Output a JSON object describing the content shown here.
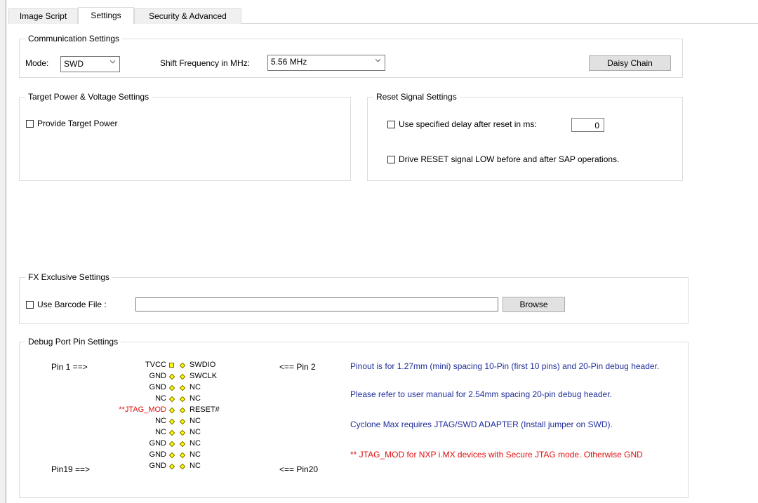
{
  "tabs": [
    {
      "label": "Image Script",
      "active": false
    },
    {
      "label": "Settings",
      "active": true
    },
    {
      "label": "Security & Advanced",
      "active": false
    }
  ],
  "communication": {
    "title": "Communication Settings",
    "mode_label": "Mode:",
    "mode_value": "SWD",
    "freq_label": "Shift Frequency in MHz:",
    "freq_value": "5.56 MHz",
    "daisy_chain_button": "Daisy Chain"
  },
  "target_power": {
    "title": "Target Power & Voltage Settings",
    "provide_power_label": "Provide Target Power",
    "provide_power_checked": false
  },
  "reset_signal": {
    "title": "Reset Signal Settings",
    "delay_label": "Use specified delay after reset in ms:",
    "delay_checked": false,
    "delay_value": "0",
    "drive_reset_label": "Drive RESET signal LOW before and after SAP operations.",
    "drive_reset_checked": false
  },
  "fx_exclusive": {
    "title": "FX Exclusive Settings",
    "barcode_label": "Use Barcode File :",
    "barcode_checked": false,
    "barcode_path": "",
    "browse_button": "Browse"
  },
  "debug_port": {
    "title": "Debug Port Pin Settings",
    "pin1_label": "Pin 1 ==>",
    "pin2_label": "<== Pin 2",
    "pin19_label": "Pin19 ==>",
    "pin20_label": "<== Pin20",
    "pins_left": [
      "TVCC",
      "GND",
      "GND",
      "NC",
      "**JTAG_MOD",
      "NC",
      "NC",
      "GND",
      "GND",
      "GND"
    ],
    "pins_right": [
      "SWDIO",
      "SWCLK",
      "NC",
      "NC",
      "RESET#",
      "NC",
      "NC",
      "NC",
      "NC",
      "NC"
    ],
    "note1": "Pinout is for 1.27mm (mini) spacing 10-Pin (first 10 pins) and 20-Pin debug header.",
    "note2": "Please refer to user manual for 2.54mm spacing 20-pin debug header.",
    "note3": "Cyclone Max requires JTAG/SWD ADAPTER (Install jumper on SWD).",
    "note4": "** JTAG_MOD for NXP i.MX devices with Secure JTAG mode. Otherwise GND"
  }
}
